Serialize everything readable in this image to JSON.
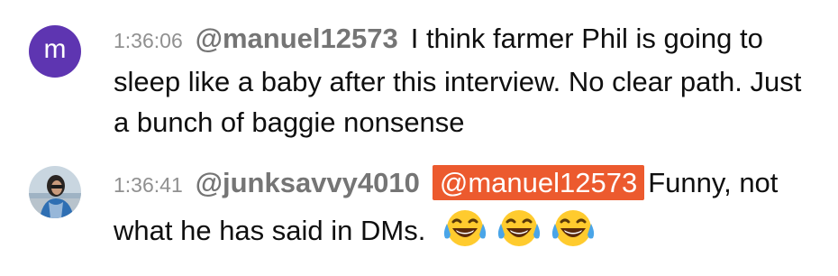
{
  "messages": [
    {
      "avatar_letter": "m",
      "timestamp": "1:36:06",
      "author": "@manuel12573",
      "text": "I think farmer Phil is going to sleep like a baby after this interview. No clear path. Just a bunch of baggie nonsense"
    },
    {
      "timestamp": "1:36:41",
      "author": "@junksavvy4010",
      "mention": "@manuel12573",
      "text": "Funny, not what he has said in DMs.",
      "emojis": [
        "face-with-tears-of-joy-icon",
        "face-with-tears-of-joy-icon",
        "face-with-tears-of-joy-icon"
      ]
    }
  ],
  "colors": {
    "avatar_bg": "#5e35b1",
    "mention_bg": "#ec5a2e",
    "author_text": "#757575",
    "timestamp_text": "#909090"
  }
}
